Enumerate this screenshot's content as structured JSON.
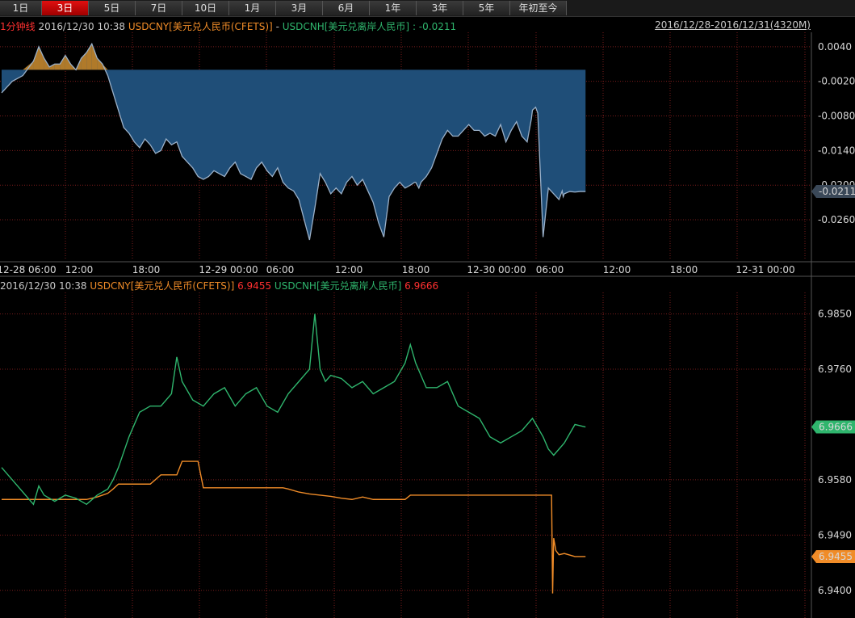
{
  "tabs": [
    "1日",
    "3日",
    "5日",
    "7日",
    "10日",
    "1月",
    "3月",
    "6月",
    "1年",
    "3年",
    "5年",
    "年初至今"
  ],
  "active_tab": 1,
  "top_panel": {
    "interval_label": "1分钟线",
    "datetime": "2016/12/30 10:38",
    "series_a": "USDCNY[美元兑人民币(CFETS)]",
    "minus": "-",
    "series_b": "USDCNH[美元兑离岸人民币]",
    "value": ": -0.0211",
    "range": "2016/12/28-2016/12/31(4320M)"
  },
  "bottom_panel": {
    "datetime": "2016/12/30 10:38",
    "series_a": "USDCNY[美元兑人民币(CFETS)]",
    "series_a_value": "6.9455",
    "series_b": "USDCNH[美元兑离岸人民币]",
    "series_b_value": "6.9666"
  },
  "colors": {
    "cny": "#f08c28",
    "cnh": "#2fb56d",
    "spread_fill": "#1f4e78",
    "spread_line": "#9ab0c8",
    "positive_fill": "#b07a2a"
  },
  "chart_data": [
    {
      "type": "area",
      "title": "USDCNY - USDCNH spread",
      "x_ticks": [
        "12-28 06:00",
        "12:00",
        "18:00",
        "12-29 00:00",
        "06:00",
        "12:00",
        "18:00",
        "12-30 00:00",
        "06:00",
        "12:00",
        "18:00",
        "12-31 00:00"
      ],
      "y_ticks": [
        "0.0040",
        "-0.0020",
        "-0.0080",
        "-0.0140",
        "-0.0200",
        "-0.0260"
      ],
      "ylim": [
        -0.033,
        0.0065
      ],
      "baseline": 0,
      "current_value": "-0.0211",
      "series": [
        {
          "name": "USDCNY-USDCNH",
          "x": [
            0,
            1,
            2,
            3,
            3.5,
            4,
            4.5,
            5,
            5.5,
            6,
            6.5,
            7,
            7.5,
            8,
            8.5,
            9,
            9.5,
            10,
            10.5,
            11,
            11.5,
            12,
            12.5,
            13,
            13.5,
            14,
            14.5,
            15,
            15.5,
            16,
            16.5,
            17,
            17.5,
            18,
            18.5,
            19,
            19.5,
            20,
            20.5,
            21,
            21.5,
            22,
            22.5,
            23,
            23.5,
            24,
            24.5,
            25,
            25.5,
            26,
            26.5,
            27,
            27.5,
            28,
            28.5,
            29,
            29.5,
            30,
            30.5,
            31,
            31.5,
            32,
            32.5,
            33,
            33.5,
            34,
            34.5,
            35,
            35.5,
            36,
            36.5,
            37,
            37.5,
            38,
            38.5,
            38.9,
            39,
            39.3,
            39.5,
            40,
            40.5,
            41,
            41.5,
            42,
            42.5,
            43,
            43.5,
            44,
            44.5,
            45,
            45.5,
            46,
            46.5,
            47,
            47.5,
            48,
            48.5,
            49,
            49.5,
            49.9,
            50,
            50.3,
            50.5,
            51,
            51.5,
            52,
            52.5,
            52.8,
            52.9,
            53,
            53.5,
            54,
            54.5,
            55
          ],
          "values": [
            -0.004,
            -0.002,
            -0.001,
            0.0015,
            0.004,
            0.002,
            0.0005,
            0.001,
            0.001,
            0.0025,
            0.001,
            0,
            0.002,
            0.003,
            0.0045,
            0.002,
            0.001,
            -0.001,
            -0.004,
            -0.007,
            -0.01,
            -0.011,
            -0.0125,
            -0.0135,
            -0.012,
            -0.013,
            -0.0145,
            -0.014,
            -0.012,
            -0.013,
            -0.0125,
            -0.015,
            -0.016,
            -0.017,
            -0.0185,
            -0.019,
            -0.0185,
            -0.0175,
            -0.018,
            -0.0185,
            -0.017,
            -0.016,
            -0.018,
            -0.0185,
            -0.019,
            -0.017,
            -0.016,
            -0.0175,
            -0.0185,
            -0.017,
            -0.0195,
            -0.0205,
            -0.021,
            -0.0225,
            -0.026,
            -0.0295,
            -0.024,
            -0.018,
            -0.0195,
            -0.0215,
            -0.0205,
            -0.0215,
            -0.0195,
            -0.0185,
            -0.02,
            -0.019,
            -0.021,
            -0.023,
            -0.0265,
            -0.029,
            -0.022,
            -0.0205,
            -0.0195,
            -0.0205,
            -0.02,
            -0.0195,
            -0.0195,
            -0.0205,
            -0.0195,
            -0.0185,
            -0.017,
            -0.0145,
            -0.012,
            -0.0105,
            -0.0115,
            -0.0115,
            -0.0105,
            -0.0095,
            -0.0105,
            -0.0105,
            -0.0115,
            -0.011,
            -0.0115,
            -0.0095,
            -0.0125,
            -0.0105,
            -0.009,
            -0.0115,
            -0.0125,
            -0.0085,
            -0.007,
            -0.0065,
            -0.0075,
            -0.029,
            -0.0205,
            -0.0215,
            -0.0225,
            -0.021,
            -0.022,
            -0.0215,
            -0.0211,
            -0.0212,
            -0.0211,
            -0.0211
          ]
        }
      ]
    },
    {
      "type": "line",
      "title": "USDCNY vs USDCNH",
      "x_ticks": [
        "12-28 06:00",
        "12:00",
        "18:00",
        "12-29 00:00",
        "06:00",
        "12:00",
        "18:00",
        "12-30 00:00",
        "06:00",
        "12:00",
        "18:00",
        "12-31 00:00"
      ],
      "y_ticks": [
        "6.9850",
        "6.9760",
        "6.9580",
        "6.9490",
        "6.9400"
      ],
      "ylim": [
        6.9355,
        6.9885
      ],
      "series": [
        {
          "name": "USDCNY",
          "current_value": "6.9455",
          "x": [
            0,
            8,
            9,
            9.5,
            10,
            10.5,
            11,
            12,
            13,
            14,
            15,
            16,
            16.5,
            17,
            18,
            18.5,
            19,
            19.5,
            20,
            21,
            22,
            23,
            24,
            25,
            26,
            26.5,
            27,
            28,
            29,
            30,
            31,
            32,
            33,
            34,
            35,
            36,
            37,
            38,
            38.5,
            39,
            40,
            41,
            42,
            43,
            44,
            45,
            46,
            47,
            48,
            49,
            50,
            51,
            51.5,
            51.8,
            51.9,
            52,
            52.2,
            52.5,
            53,
            54,
            55
          ],
          "values": [
            6.9548,
            6.9548,
            6.9552,
            6.9555,
            6.9558,
            6.9565,
            6.9573,
            6.9573,
            6.9573,
            6.9573,
            6.9588,
            6.9588,
            6.9588,
            6.961,
            6.961,
            6.961,
            6.9567,
            6.9567,
            6.9567,
            6.9567,
            6.9567,
            6.9567,
            6.9567,
            6.9567,
            6.9567,
            6.9567,
            6.9565,
            6.956,
            6.9557,
            6.9555,
            6.9553,
            6.955,
            6.9548,
            6.9552,
            6.9548,
            6.9548,
            6.9548,
            6.9548,
            6.9555,
            6.9555,
            6.9555,
            6.9555,
            6.9555,
            6.9555,
            6.9555,
            6.9555,
            6.9555,
            6.9555,
            6.9555,
            6.9555,
            6.9555,
            6.9555,
            6.9555,
            6.9555,
            6.9395,
            6.9485,
            6.9465,
            6.9458,
            6.946,
            6.9455,
            6.9455
          ]
        },
        {
          "name": "USDCNH",
          "current_value": "6.9666",
          "x": [
            0,
            1,
            2,
            3,
            3.5,
            4,
            5,
            6,
            7,
            8,
            9,
            10,
            10.5,
            11,
            11.5,
            12,
            13,
            14,
            15,
            16,
            16.5,
            17,
            18,
            19,
            20,
            21,
            22,
            23,
            24,
            25,
            26,
            27,
            28,
            29,
            29.5,
            30,
            30.5,
            31,
            32,
            33,
            34,
            35,
            36,
            37,
            38,
            38.5,
            39,
            40,
            41,
            42,
            43,
            44,
            45,
            46,
            47,
            48,
            49,
            50,
            51,
            51.5,
            52,
            53,
            54,
            55
          ],
          "values": [
            6.96,
            6.958,
            6.956,
            6.954,
            6.957,
            6.9555,
            6.9545,
            6.9555,
            6.955,
            6.954,
            6.9555,
            6.9565,
            6.958,
            6.96,
            6.9625,
            6.965,
            6.969,
            6.97,
            6.97,
            6.972,
            6.978,
            6.974,
            6.971,
            6.97,
            6.972,
            6.973,
            6.97,
            6.972,
            6.973,
            6.97,
            6.969,
            6.972,
            6.974,
            6.976,
            6.985,
            6.976,
            6.974,
            6.975,
            6.9745,
            6.973,
            6.974,
            6.972,
            6.973,
            6.974,
            6.977,
            6.98,
            6.977,
            6.973,
            6.973,
            6.974,
            6.97,
            6.969,
            6.968,
            6.965,
            6.964,
            6.965,
            6.966,
            6.968,
            6.965,
            6.963,
            6.962,
            6.964,
            6.967,
            6.9666
          ]
        }
      ]
    }
  ]
}
